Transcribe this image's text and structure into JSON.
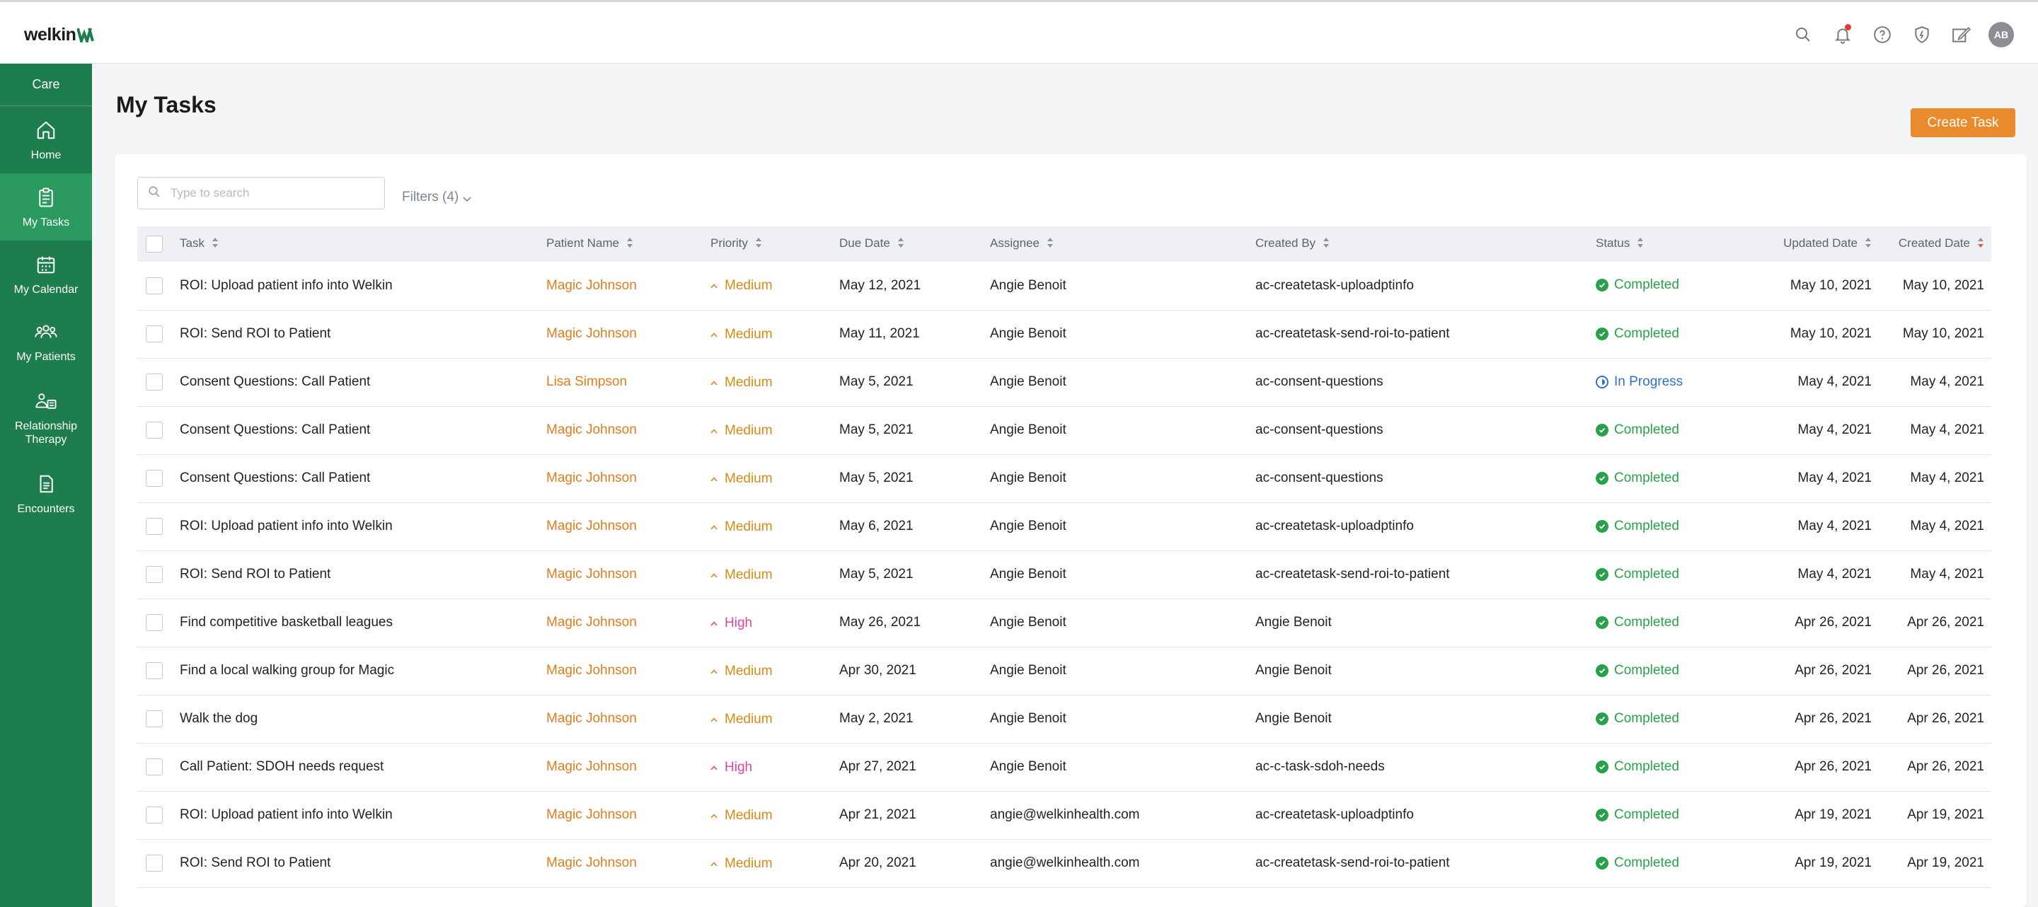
{
  "app": {
    "logo_text": "welkin",
    "avatar_initials": "AB"
  },
  "top_icons": [
    "search-icon",
    "bell-icon",
    "help-icon",
    "shield-icon",
    "edit-icon"
  ],
  "sidebar": {
    "header": "Care",
    "items": [
      {
        "label": "Home",
        "icon": "home-icon",
        "active": false
      },
      {
        "label": "My Tasks",
        "icon": "clipboard-icon",
        "active": true
      },
      {
        "label": "My Calendar",
        "icon": "calendar-icon",
        "active": false
      },
      {
        "label": "My Patients",
        "icon": "people-icon",
        "active": false
      },
      {
        "label": "Relationship Therapy",
        "icon": "relationship-icon",
        "active": false
      },
      {
        "label": "Encounters",
        "icon": "document-icon",
        "active": false
      }
    ]
  },
  "page": {
    "title": "My Tasks",
    "create_button": "Create Task"
  },
  "toolbar": {
    "search_placeholder": "Type to search",
    "filters_label": "Filters (4)"
  },
  "table": {
    "columns": [
      "Task",
      "Patient Name",
      "Priority",
      "Due Date",
      "Assignee",
      "Created By",
      "Status",
      "Updated Date",
      "Created Date"
    ],
    "sorted_column": "Created Date",
    "rows": [
      {
        "task": "ROI: Upload patient info into Welkin",
        "patient": "Magic Johnson",
        "priority": "Medium",
        "due": "May 12, 2021",
        "assignee": "Angie Benoit",
        "created_by": "ac-createtask-uploadptinfo",
        "status": "Completed",
        "updated": "May 10, 2021",
        "created": "May 10, 2021"
      },
      {
        "task": "ROI: Send ROI to Patient",
        "patient": "Magic Johnson",
        "priority": "Medium",
        "due": "May 11, 2021",
        "assignee": "Angie Benoit",
        "created_by": "ac-createtask-send-roi-to-patient",
        "status": "Completed",
        "updated": "May 10, 2021",
        "created": "May 10, 2021"
      },
      {
        "task": "Consent Questions: Call Patient",
        "patient": "Lisa Simpson",
        "priority": "Medium",
        "due": "May 5, 2021",
        "assignee": "Angie Benoit",
        "created_by": "ac-consent-questions",
        "status": "In Progress",
        "updated": "May 4, 2021",
        "created": "May 4, 2021"
      },
      {
        "task": "Consent Questions: Call Patient",
        "patient": "Magic Johnson",
        "priority": "Medium",
        "due": "May 5, 2021",
        "assignee": "Angie Benoit",
        "created_by": "ac-consent-questions",
        "status": "Completed",
        "updated": "May 4, 2021",
        "created": "May 4, 2021"
      },
      {
        "task": "Consent Questions: Call Patient",
        "patient": "Magic Johnson",
        "priority": "Medium",
        "due": "May 5, 2021",
        "assignee": "Angie Benoit",
        "created_by": "ac-consent-questions",
        "status": "Completed",
        "updated": "May 4, 2021",
        "created": "May 4, 2021"
      },
      {
        "task": "ROI: Upload patient info into Welkin",
        "patient": "Magic Johnson",
        "priority": "Medium",
        "due": "May 6, 2021",
        "assignee": "Angie Benoit",
        "created_by": "ac-createtask-uploadptinfo",
        "status": "Completed",
        "updated": "May 4, 2021",
        "created": "May 4, 2021"
      },
      {
        "task": "ROI: Send ROI to Patient",
        "patient": "Magic Johnson",
        "priority": "Medium",
        "due": "May 5, 2021",
        "assignee": "Angie Benoit",
        "created_by": "ac-createtask-send-roi-to-patient",
        "status": "Completed",
        "updated": "May 4, 2021",
        "created": "May 4, 2021"
      },
      {
        "task": "Find competitive basketball leagues",
        "patient": "Magic Johnson",
        "priority": "High",
        "due": "May 26, 2021",
        "assignee": "Angie Benoit",
        "created_by": "Angie Benoit",
        "status": "Completed",
        "updated": "Apr 26, 2021",
        "created": "Apr 26, 2021"
      },
      {
        "task": "Find a local walking group for Magic",
        "patient": "Magic Johnson",
        "priority": "Medium",
        "due": "Apr 30, 2021",
        "assignee": "Angie Benoit",
        "created_by": "Angie Benoit",
        "status": "Completed",
        "updated": "Apr 26, 2021",
        "created": "Apr 26, 2021"
      },
      {
        "task": "Walk the dog",
        "patient": "Magic Johnson",
        "priority": "Medium",
        "due": "May 2, 2021",
        "assignee": "Angie Benoit",
        "created_by": "Angie Benoit",
        "status": "Completed",
        "updated": "Apr 26, 2021",
        "created": "Apr 26, 2021"
      },
      {
        "task": "Call Patient: SDOH needs request",
        "patient": "Magic Johnson",
        "priority": "High",
        "due": "Apr 27, 2021",
        "assignee": "Angie Benoit",
        "created_by": "ac-c-task-sdoh-needs",
        "status": "Completed",
        "updated": "Apr 26, 2021",
        "created": "Apr 26, 2021"
      },
      {
        "task": "ROI: Upload patient info into Welkin",
        "patient": "Magic Johnson",
        "priority": "Medium",
        "due": "Apr 21, 2021",
        "assignee": "angie@welkinhealth.com",
        "created_by": "ac-createtask-uploadptinfo",
        "status": "Completed",
        "updated": "Apr 19, 2021",
        "created": "Apr 19, 2021"
      },
      {
        "task": "ROI: Send ROI to Patient",
        "patient": "Magic Johnson",
        "priority": "Medium",
        "due": "Apr 20, 2021",
        "assignee": "angie@welkinhealth.com",
        "created_by": "ac-createtask-send-roi-to-patient",
        "status": "Completed",
        "updated": "Apr 19, 2021",
        "created": "Apr 19, 2021"
      }
    ]
  },
  "colors": {
    "sidebar": "#1e7d4c",
    "sidebar_active": "#2a9a5e",
    "accent": "#e98a2c",
    "patient_link": "#e07b1f",
    "priority_medium": "#d68a14",
    "priority_high": "#e0439a",
    "status_completed": "#27a14a",
    "status_in_progress": "#2f6fd0"
  }
}
